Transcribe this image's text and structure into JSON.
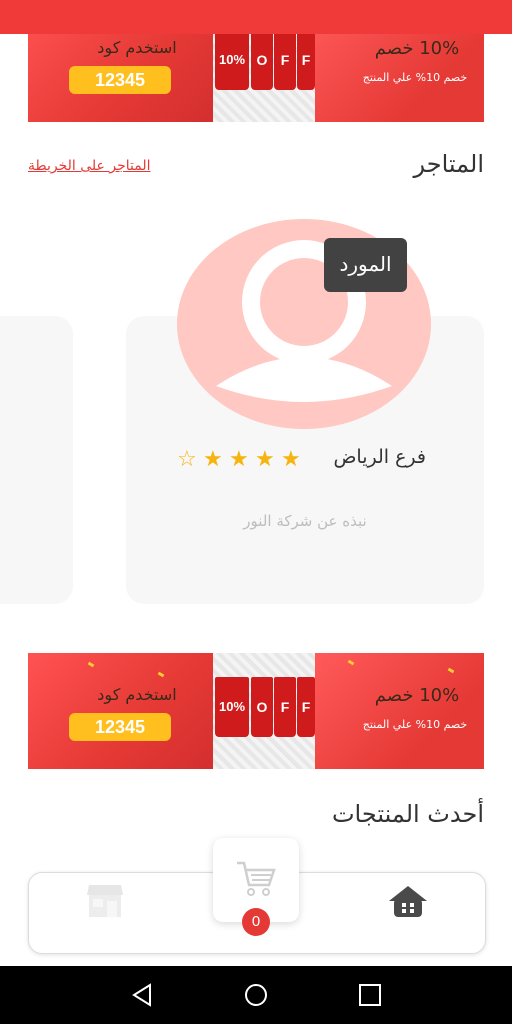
{
  "banner": {
    "use_code": "استخدم كود",
    "code": "12345",
    "tag_letters": [
      "10%",
      "O",
      "F",
      "F"
    ],
    "discount_title": "10% خصم",
    "discount_sub": "خصم 10% علي المنتج"
  },
  "stores": {
    "title": "المتاجر",
    "map_link": "المتاجر على الخريطة",
    "card": {
      "badge": "المورد",
      "name": "فرع الرياض",
      "rating": 4.5,
      "about": "نبذه عن شركة النور"
    }
  },
  "latest_products": {
    "title": "أحدث المنتجات"
  },
  "bottom_nav": {
    "cart_count": "0",
    "items": [
      "store-icon",
      "cart-icon",
      "home-icon"
    ]
  },
  "colors": {
    "accent": "#e53935",
    "badge_bg": "#424242",
    "star": "#f6b40e",
    "avatar": "#ffc8c2"
  }
}
